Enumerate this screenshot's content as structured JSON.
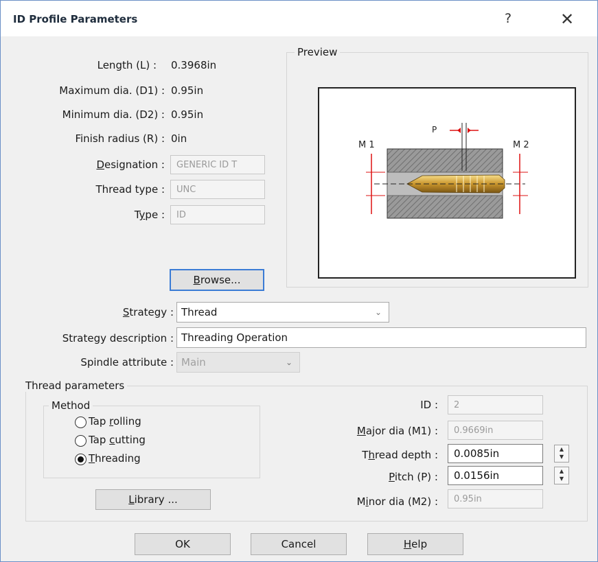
{
  "window": {
    "title": "ID Profile Parameters",
    "help_glyph": "?",
    "close_glyph": "✕"
  },
  "profile": {
    "length_label": "Length (L) :",
    "length_value": "0.3968in",
    "max_dia_label": "Maximum dia. (D1) :",
    "max_dia_value": "0.95in",
    "min_dia_label": "Minimum dia. (D2) :",
    "min_dia_value": "0.95in",
    "finish_radius_label": "Finish radius (R) :",
    "finish_radius_value": "0in",
    "designation_label_pre": "",
    "designation_label_u": "D",
    "designation_label_post": "esignation :",
    "designation_value": "GENERIC ID T",
    "thread_type_label": "Thread type :",
    "thread_type_value": "UNC",
    "type_label_pre": "T",
    "type_label_u": "y",
    "type_label_post": "pe :",
    "type_value": "ID",
    "browse_pre": "",
    "browse_u": "B",
    "browse_post": "rowse..."
  },
  "preview": {
    "label": "Preview",
    "m1": "M 1",
    "m2": "M 2",
    "p": "P"
  },
  "strategy": {
    "label_u": "S",
    "label_post": "trategy :",
    "value": "Thread",
    "desc_label": "Strategy description :",
    "desc_value": "Threading Operation",
    "spindle_label": "Spindle attribute :",
    "spindle_value": "Main"
  },
  "thread_params": {
    "group_label": "Thread parameters",
    "method_label": "Method",
    "methods": [
      {
        "pre": "Tap ",
        "u": "r",
        "post": "olling",
        "selected": false
      },
      {
        "pre": "Tap ",
        "u": "c",
        "post": "utting",
        "selected": false
      },
      {
        "pre": "",
        "u": "T",
        "post": "hreading",
        "selected": true
      }
    ],
    "library_pre": "",
    "library_u": "L",
    "library_post": "ibrary ...",
    "id_label": "ID :",
    "id_value": "2",
    "major_label_u": "M",
    "major_label_post": "ajor dia (M1) :",
    "major_value": "0.9669in",
    "depth_label_pre": "T",
    "depth_label_u": "h",
    "depth_label_post": "read depth :",
    "depth_value": "0.0085in",
    "pitch_label_u": "P",
    "pitch_label_post": "itch (P) :",
    "pitch_value": "0.0156in",
    "minor_label_pre": "M",
    "minor_label_u": "i",
    "minor_label_post": "nor dia (M2) :",
    "minor_value": "0.95in"
  },
  "buttons": {
    "ok": "OK",
    "cancel": "Cancel",
    "help_u": "H",
    "help_post": "elp"
  }
}
